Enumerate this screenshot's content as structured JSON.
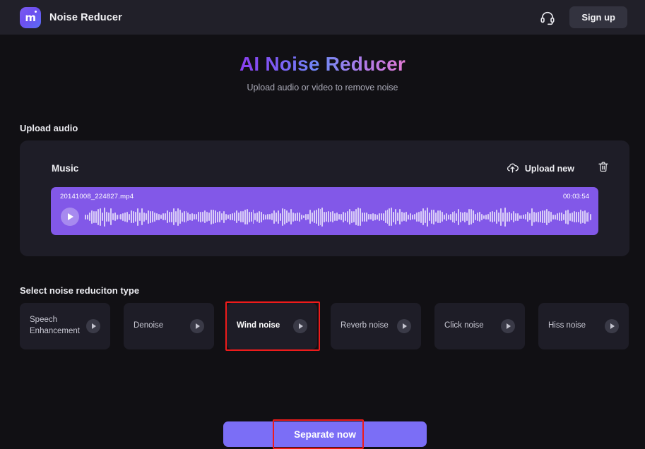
{
  "header": {
    "brand_name": "Noise Reducer",
    "logo_glyph": "m",
    "logo_icon_name": "app-logo-icon",
    "support_icon": "headset-support-icon",
    "signup_label": "Sign up"
  },
  "hero": {
    "title": "AI Noise Reducer",
    "subtitle": "Upload audio or video to remove noise"
  },
  "upload_section": {
    "label": "Upload audio",
    "card_title": "Music",
    "upload_new_label": "Upload new",
    "upload_icon": "cloud-upload-icon",
    "delete_icon": "trash-icon",
    "track": {
      "file_name": "20141008_224827.mp4",
      "duration": "00:03:54",
      "play_icon": "play-icon"
    }
  },
  "types_section": {
    "label": "Select noise reduciton type",
    "cards": [
      {
        "label": "Speech Enhancement",
        "selected": false
      },
      {
        "label": "Denoise",
        "selected": false
      },
      {
        "label": "Wind noise",
        "selected": true
      },
      {
        "label": "Reverb noise",
        "selected": false
      },
      {
        "label": "Click noise",
        "selected": false
      },
      {
        "label": "Hiss noise",
        "selected": false
      }
    ]
  },
  "footer": {
    "separate_label": "Separate now"
  },
  "colors": {
    "page_bg": "#111014",
    "panel_bg": "#1e1d27",
    "header_bg": "#212029",
    "accent_purple": "#7b6ef6",
    "track_purple": "#8258e8",
    "annotation_red": "#ee1b1b"
  }
}
